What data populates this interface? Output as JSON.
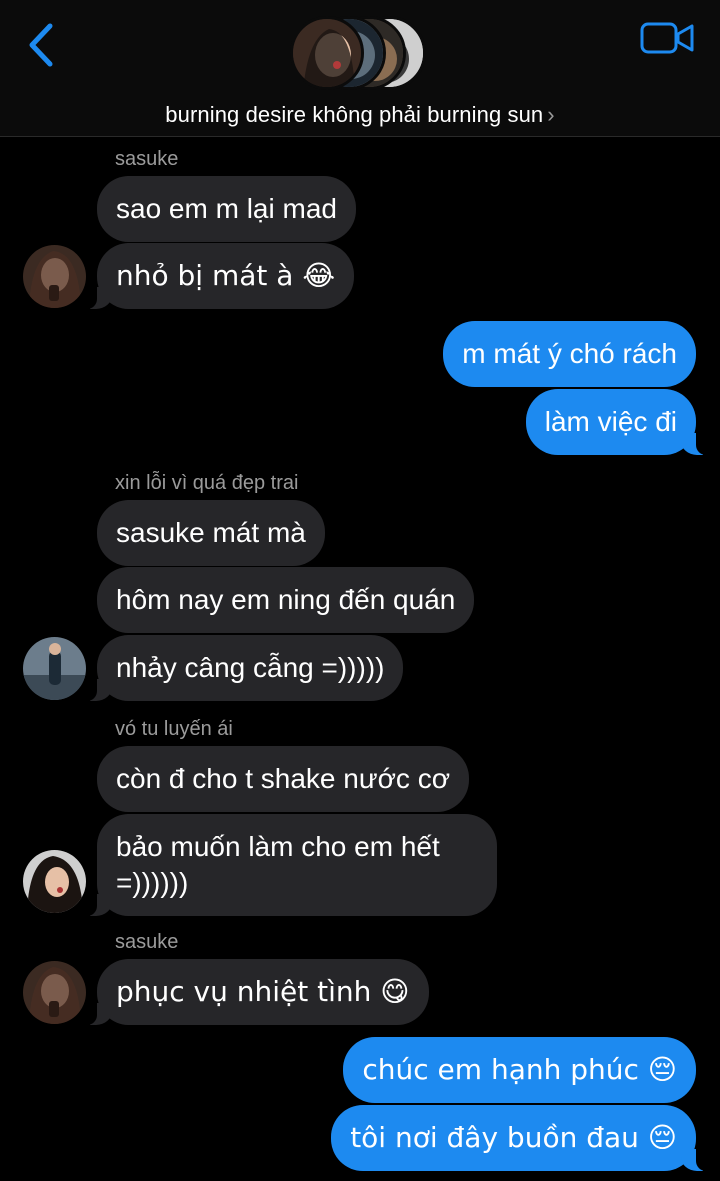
{
  "header": {
    "group_name": "burning desire không phải burning sun",
    "chevron": "›",
    "back_icon": "chevron-left-icon",
    "video_icon": "video-camera-icon",
    "accent_color": "#1d8af0"
  },
  "messages": [
    {
      "sender": "sasuke",
      "text": "sao em m lại mad",
      "direction": "incoming"
    },
    {
      "text": "nhỏ bị mát à 😂",
      "direction": "incoming"
    },
    {
      "text": "m mát ý chó rách",
      "direction": "outgoing"
    },
    {
      "text": "làm việc đi",
      "direction": "outgoing"
    },
    {
      "sender": "xin lỗi vì quá đẹp trai",
      "text": "sasuke mát mà",
      "direction": "incoming"
    },
    {
      "text": "hôm nay em ning đến quán",
      "direction": "incoming"
    },
    {
      "text": "nhảy câng cẫng =)))))",
      "direction": "incoming"
    },
    {
      "sender": "vó tu luyến ái",
      "text": "còn đ cho t shake nước cơ",
      "direction": "incoming"
    },
    {
      "text_line1": "bảo muốn làm cho em hết",
      "text_line2": "=))))))",
      "direction": "incoming"
    },
    {
      "sender": "sasuke",
      "text": "phục vụ nhiệt tình 😋",
      "direction": "incoming"
    },
    {
      "text": "chúc em hạnh phúc 😔",
      "direction": "outgoing"
    },
    {
      "text": "tôi nơi đây buồn đau 😔",
      "direction": "outgoing"
    }
  ]
}
